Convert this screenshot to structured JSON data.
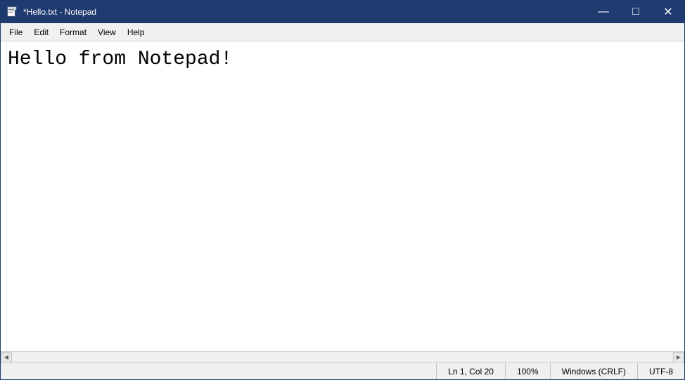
{
  "window": {
    "title": "*Hello.txt - Notepad"
  },
  "titlebar": {
    "minimize_label": "—",
    "maximize_label": "□",
    "close_label": "✕"
  },
  "menubar": {
    "items": [
      {
        "label": "File",
        "id": "file"
      },
      {
        "label": "Edit",
        "id": "edit"
      },
      {
        "label": "Format",
        "id": "format"
      },
      {
        "label": "View",
        "id": "view"
      },
      {
        "label": "Help",
        "id": "help"
      }
    ]
  },
  "editor": {
    "content": "Hello from Notepad!"
  },
  "hscroll": {
    "left_arrow": "◀",
    "right_arrow": "▶"
  },
  "statusbar": {
    "position": "Ln 1, Col 20",
    "zoom": "100%",
    "line_ending": "Windows (CRLF)",
    "encoding": "UTF-8"
  }
}
